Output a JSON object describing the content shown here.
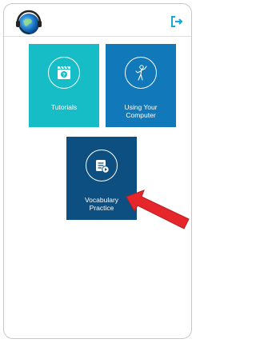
{
  "header": {
    "logo_icon": "headset-globe-logo-icon",
    "logout_icon": "logout-icon"
  },
  "tiles": [
    {
      "label": "Tutorials",
      "icon": "clapperboard-question-icon",
      "color": "#16bcc6"
    },
    {
      "label": "Using Your\nComputer",
      "icon": "person-gesturing-icon",
      "color": "#1178b9"
    },
    {
      "label": "Vocabulary\nPractice",
      "icon": "list-play-icon",
      "color": "#0d4f80"
    }
  ],
  "annotation": {
    "icon": "red-arrow-icon",
    "color": "#e5262b"
  }
}
